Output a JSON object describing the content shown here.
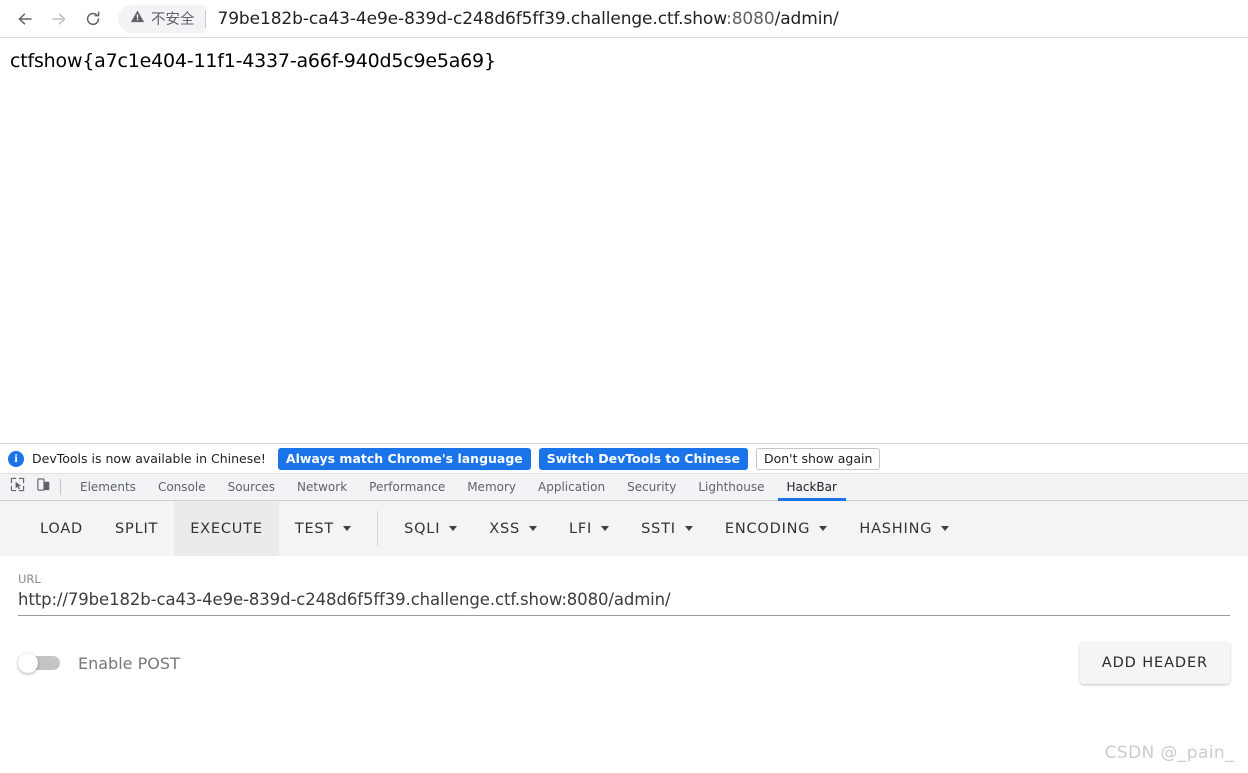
{
  "browser": {
    "back_icon": "arrow-left-icon",
    "forward_icon": "arrow-right-icon",
    "reload_icon": "reload-icon",
    "security_icon": "warning-triangle-icon",
    "security_label": "不安全",
    "url_host": "79be182b-ca43-4e9e-839d-c248d6f5ff39.challenge.ctf.show",
    "url_port": ":8080",
    "url_path": "/admin/"
  },
  "page": {
    "flag": "ctfshow{a7c1e404-11f1-4337-a66f-940d5c9e5a69}"
  },
  "devtools": {
    "notification": {
      "icon": "info-icon",
      "icon_glyph": "i",
      "message": "DevTools is now available in Chinese!",
      "buttons": [
        {
          "label": "Always match Chrome's language",
          "style": "primary"
        },
        {
          "label": "Switch DevTools to Chinese",
          "style": "primary"
        },
        {
          "label": "Don't show again",
          "style": "secondary"
        }
      ]
    },
    "left_icons": [
      {
        "name": "inspect-element-icon"
      },
      {
        "name": "device-toolbar-icon"
      }
    ],
    "tabs": [
      {
        "label": "Elements",
        "active": false
      },
      {
        "label": "Console",
        "active": false
      },
      {
        "label": "Sources",
        "active": false
      },
      {
        "label": "Network",
        "active": false
      },
      {
        "label": "Performance",
        "active": false
      },
      {
        "label": "Memory",
        "active": false
      },
      {
        "label": "Application",
        "active": false
      },
      {
        "label": "Security",
        "active": false
      },
      {
        "label": "Lighthouse",
        "active": false
      },
      {
        "label": "HackBar",
        "active": true
      }
    ],
    "active_tab_color": "#1a73e8"
  },
  "hackbar": {
    "toolbar": [
      {
        "label": "LOAD",
        "caret": false,
        "highlight": false
      },
      {
        "label": "SPLIT",
        "caret": false,
        "highlight": false
      },
      {
        "label": "EXECUTE",
        "caret": false,
        "highlight": true
      },
      {
        "label": "TEST",
        "caret": true,
        "highlight": false
      },
      {
        "divider": true
      },
      {
        "label": "SQLI",
        "caret": true,
        "highlight": false
      },
      {
        "label": "XSS",
        "caret": true,
        "highlight": false
      },
      {
        "label": "LFI",
        "caret": true,
        "highlight": false
      },
      {
        "label": "SSTI",
        "caret": true,
        "highlight": false
      },
      {
        "label": "ENCODING",
        "caret": true,
        "highlight": false
      },
      {
        "label": "HASHING",
        "caret": true,
        "highlight": false
      }
    ],
    "url_label": "URL",
    "url_value": "http://79be182b-ca43-4e9e-839d-c248d6f5ff39.challenge.ctf.show:8080/admin/",
    "enable_post_label": "Enable POST",
    "enable_post_checked": false,
    "add_header_label": "ADD HEADER"
  },
  "watermark": "CSDN @_pain_"
}
